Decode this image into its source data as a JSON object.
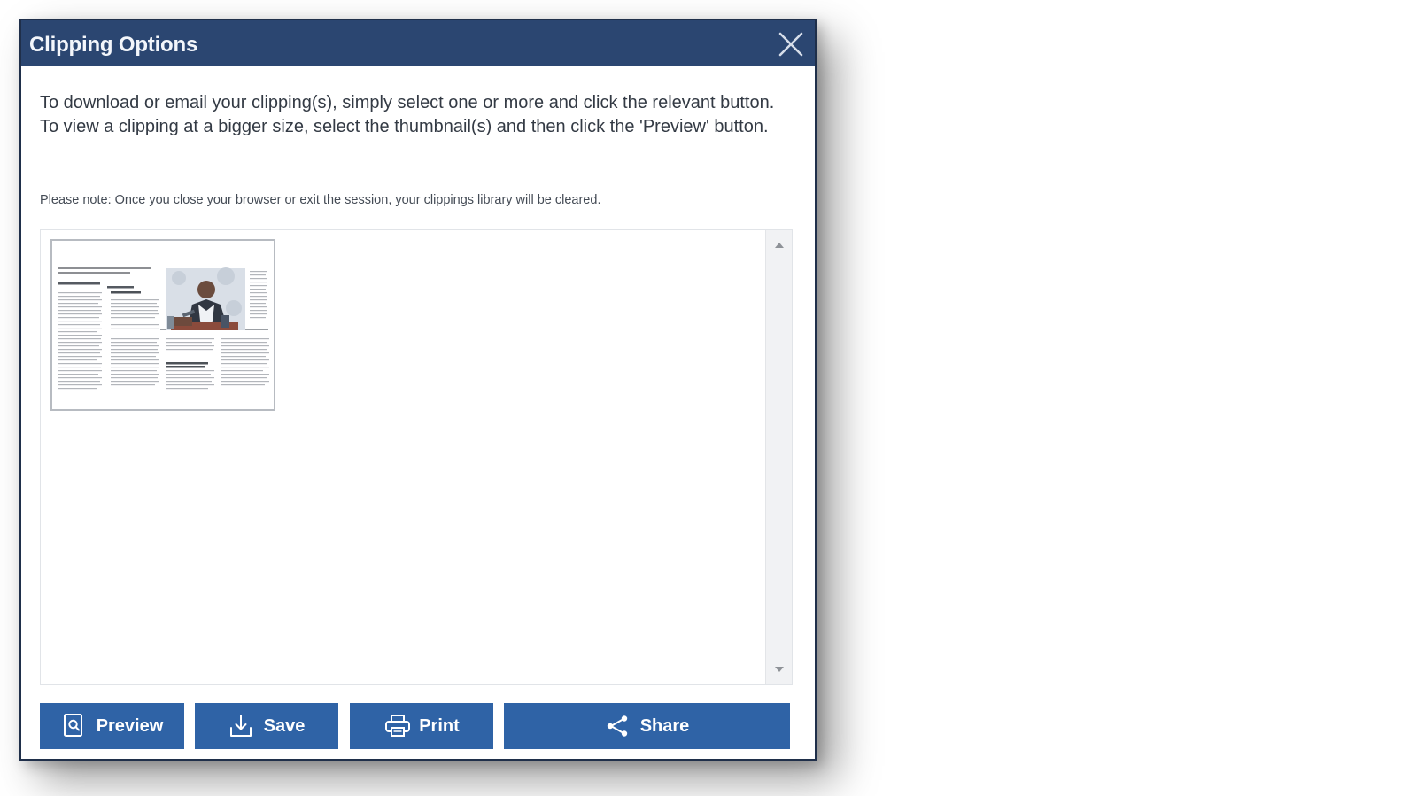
{
  "dialog": {
    "title": "Clipping Options",
    "close_icon": "close-icon",
    "instructions": "To download or email your clipping(s), simply select one or more and click the relevant button. To view a clipping at a bigger size, select the thumbnail(s) and then click the 'Preview' button.",
    "note": "Please note: Once you close your browser or exit the session, your clippings library will be cleared."
  },
  "library": {
    "thumbnails": [
      {
        "icon": "newspaper-clipping-thumbnail"
      }
    ],
    "scrollbar": {
      "up_icon": "chevron-up-icon",
      "down_icon": "chevron-down-icon"
    }
  },
  "buttons": {
    "preview": {
      "label": "Preview",
      "icon": "preview-icon"
    },
    "save": {
      "label": "Save",
      "icon": "download-icon"
    },
    "print": {
      "label": "Print",
      "icon": "printer-icon"
    },
    "share": {
      "label": "Share",
      "icon": "share-icon"
    }
  },
  "colors": {
    "titlebar": "#2b4671",
    "button": "#2f63a6",
    "title_text": "#ffffff",
    "body_text": "#333a44"
  }
}
